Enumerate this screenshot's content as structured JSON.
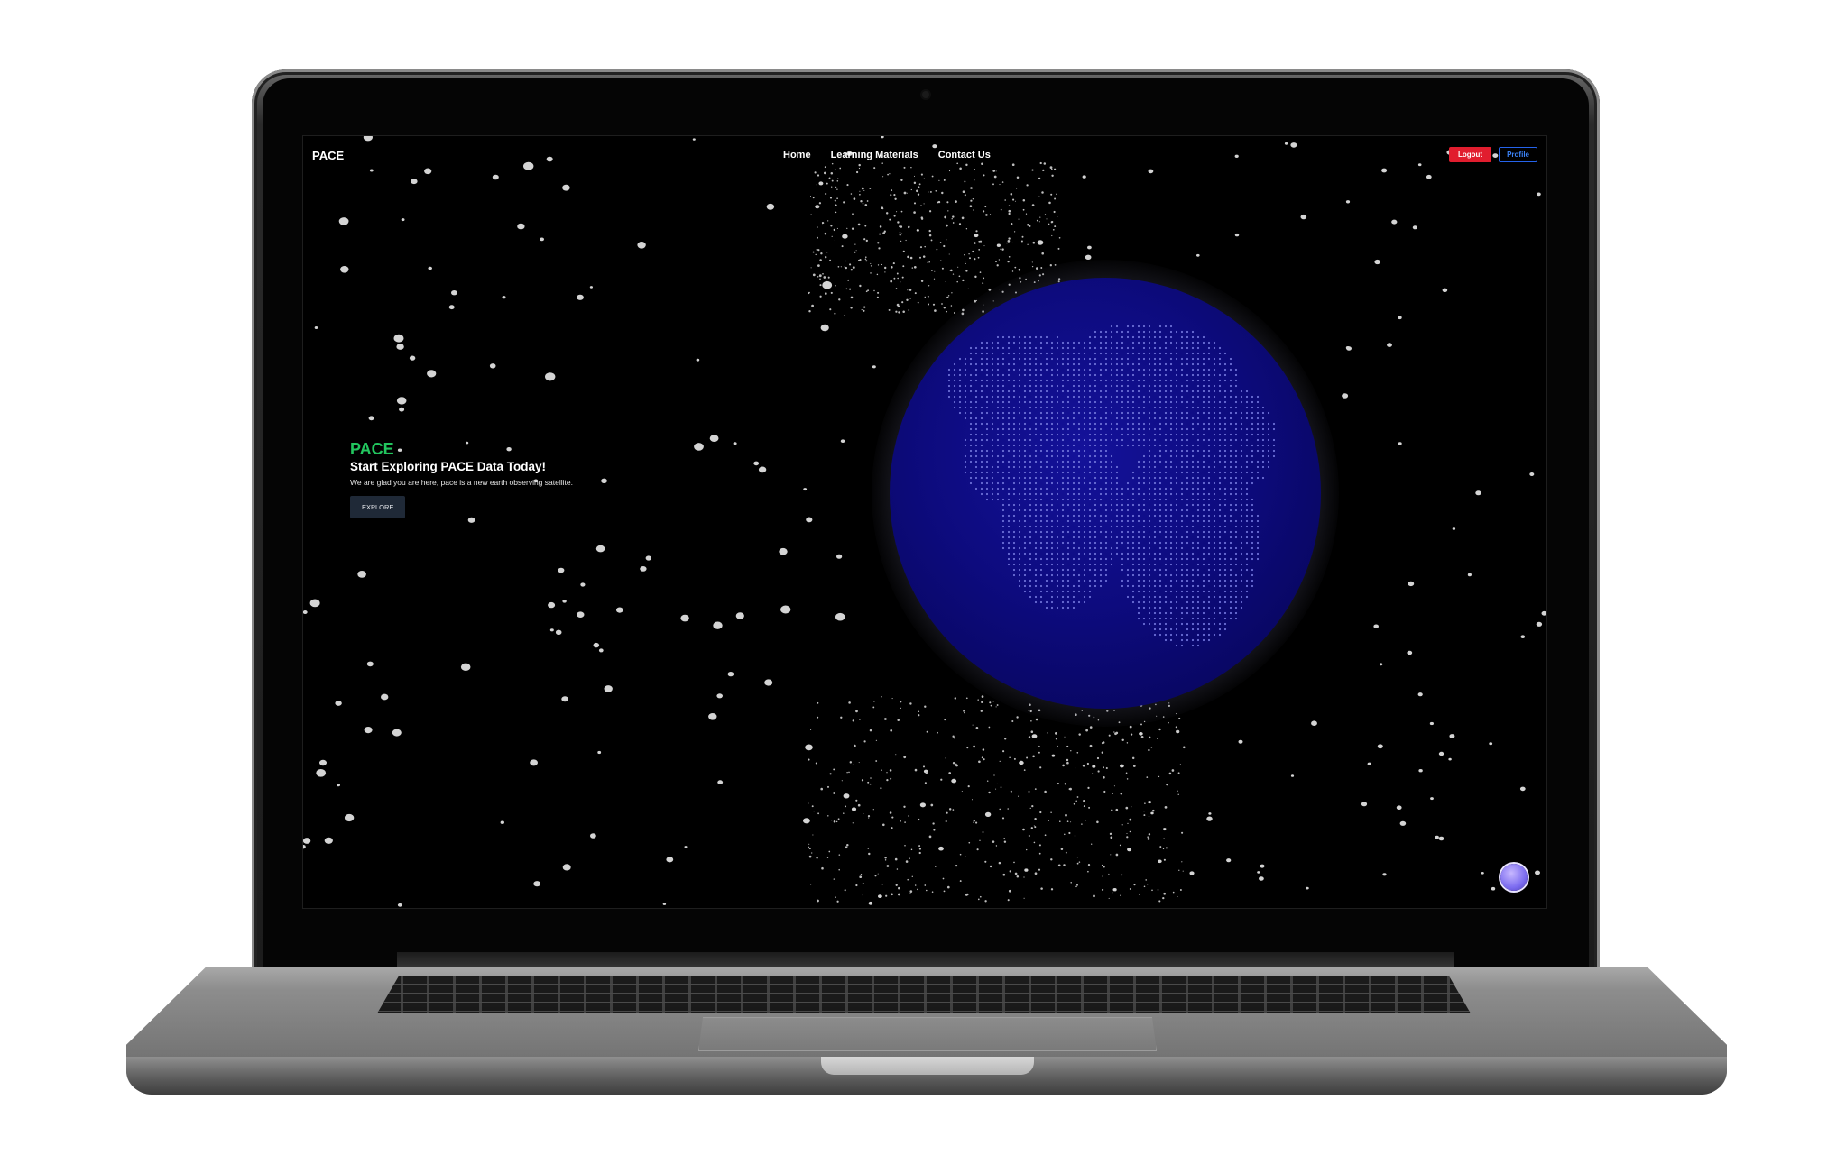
{
  "nav": {
    "brand": "PACE",
    "links": [
      "Home",
      "Learning Materials",
      "Contact Us"
    ],
    "logout_label": "Logout",
    "profile_label": "Profile"
  },
  "hero": {
    "brand": "PACE",
    "title": "Start Exploring PACE Data Today!",
    "description": "We are glad you are here, pace is a new earth observing satellite.",
    "button_label": "EXPLORE"
  },
  "icons": {
    "avatar": "astronaut-avatar-icon",
    "globe": "earth-globe-icon"
  },
  "colors": {
    "accent_green": "#22c55e",
    "logout_red": "#e11d2e",
    "profile_blue": "#2563eb",
    "globe_blue": "#0d0b7e",
    "background": "#000000"
  }
}
